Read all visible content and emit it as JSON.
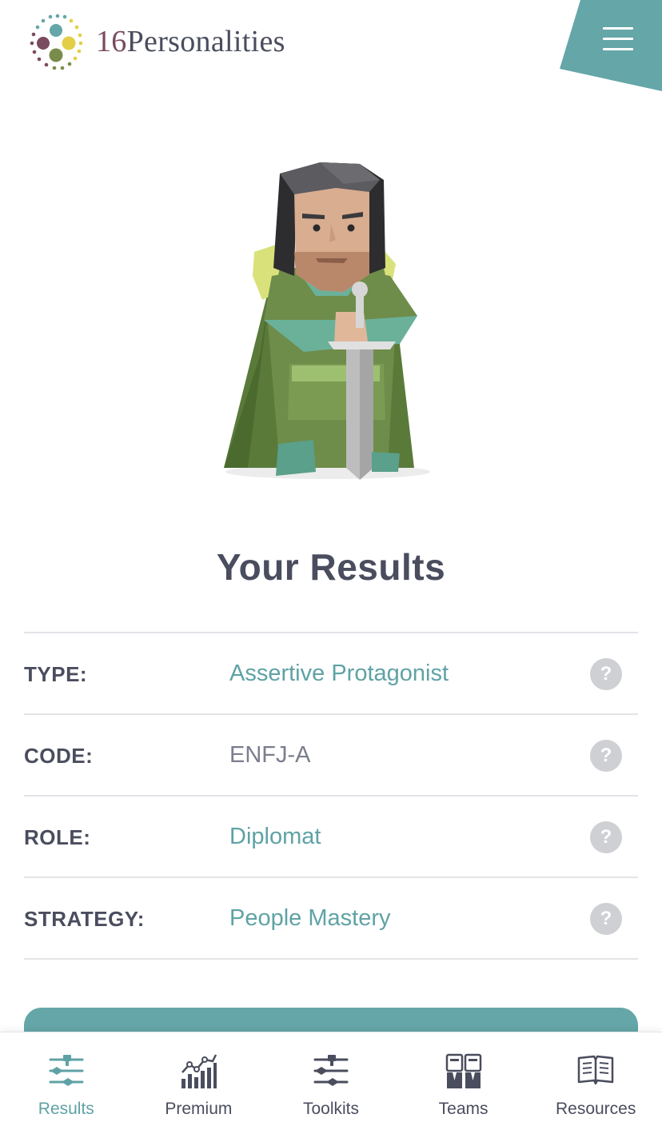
{
  "app": {
    "logo_number": "16",
    "logo_word": "Personalities",
    "accent_color": "#65a6a8",
    "text_color": "#4a4d5e"
  },
  "menu": {
    "icon": "hamburger-menu-icon"
  },
  "page": {
    "title": "Your Results"
  },
  "results": [
    {
      "label": "TYPE:",
      "value": "Assertive Protagonist",
      "value_style": "link"
    },
    {
      "label": "CODE:",
      "value": "ENFJ-A",
      "value_style": "plain"
    },
    {
      "label": "ROLE:",
      "value": "Diplomat",
      "value_style": "link"
    },
    {
      "label": "STRATEGY:",
      "value": "People Mastery",
      "value_style": "link"
    }
  ],
  "help_icon_label": "?",
  "tabs": [
    {
      "label": "Results",
      "icon": "results-sliders-icon",
      "active": true
    },
    {
      "label": "Premium",
      "icon": "premium-chart-icon",
      "active": false
    },
    {
      "label": "Toolkits",
      "icon": "toolkits-sliders-icon",
      "active": false
    },
    {
      "label": "Teams",
      "icon": "teams-people-icon",
      "active": false
    },
    {
      "label": "Resources",
      "icon": "resources-book-icon",
      "active": false
    }
  ]
}
